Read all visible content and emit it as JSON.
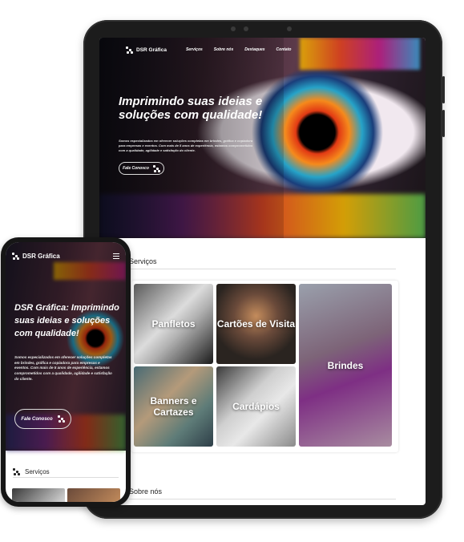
{
  "tablet": {
    "nav": {
      "brand": "DSR Gráfica",
      "links": [
        "Serviços",
        "Sobre nós",
        "Destaques",
        "Contato"
      ]
    },
    "hero": {
      "title": "Imprimindo suas ideias e soluções com qualidade!",
      "description": "Somos especializados em oferecer soluções completas em brindes, gráfica e copiadora para empresas e eventos. Com mais de 5 anos de experiência, estamos comprometidos com a qualidade, agilidade e satisfação do cliente.",
      "cta_label": "Fale Conosco"
    },
    "services": {
      "title": "Serviços",
      "cards": [
        "Panfletos",
        "Cartões de Visita",
        "Brindes",
        "Banners e Cartazes",
        "Cardápios"
      ]
    },
    "about": {
      "title": "Sobre nós"
    }
  },
  "phone": {
    "nav": {
      "brand": "DSR Gráfica"
    },
    "hero": {
      "title": "DSR Gráfica: Imprimindo suas ideias e soluções com qualidade!",
      "description": "Somos especializados em oferecer soluções completas em brindes, gráfica e copiadora para empresas e eventos. Com mais de 5 anos de experiência, estamos comprometidos com a qualidade, agilidade e satisfação do cliente.",
      "cta_label": "Fale Conosco"
    },
    "services": {
      "title": "Serviços"
    }
  },
  "icons": {
    "logo": "dots-logo-icon",
    "cta": "dots-logo-icon",
    "menu": "hamburger-menu-icon"
  },
  "colors": {
    "background": "#ffffff",
    "device_frame": "#1c1c1c",
    "hero_text": "#ffffff",
    "section_text": "#222222"
  }
}
